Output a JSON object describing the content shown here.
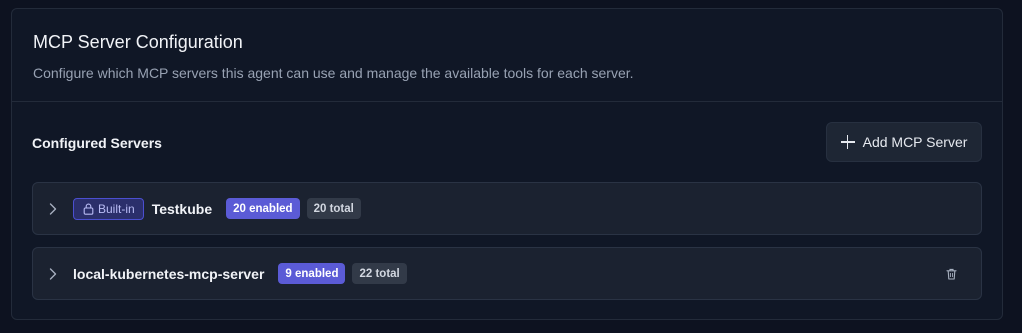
{
  "header": {
    "title": "MCP Server Configuration",
    "description": "Configure which MCP servers this agent can use and manage the available tools for each server."
  },
  "section": {
    "title": "Configured Servers",
    "add_button_label": "Add MCP Server"
  },
  "servers": [
    {
      "builtin_label": "Built-in",
      "name": "Testkube",
      "enabled_label": "20 enabled",
      "total_label": "20 total",
      "built_in": true,
      "deletable": false
    },
    {
      "name": "local-kubernetes-mcp-server",
      "enabled_label": "9 enabled",
      "total_label": "22 total",
      "built_in": false,
      "deletable": true
    }
  ],
  "icons": {
    "add": "plus-icon",
    "expand": "chevron-right-icon",
    "builtin": "lock-icon",
    "delete": "trash-icon"
  },
  "colors": {
    "enabled_badge": "#5b5bd6",
    "builtin_badge_border": "#4b4fd0",
    "background": "#0d1220"
  }
}
